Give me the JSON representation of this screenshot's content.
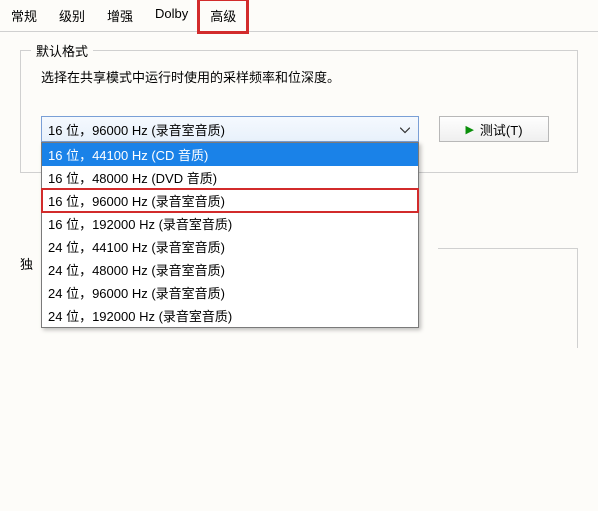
{
  "tabs": {
    "t0": "常规",
    "t1": "级别",
    "t2": "增强",
    "t3": "Dolby",
    "t4": "高级"
  },
  "group": {
    "defaultFormat": "默认格式",
    "instruction": "选择在共享模式中运行时使用的采样频率和位深度。"
  },
  "combo": {
    "selected": "16 位，96000 Hz (录音室音质)"
  },
  "options": {
    "o0": "16 位，44100 Hz (CD 音质)",
    "o1": "16 位，48000 Hz (DVD 音质)",
    "o2": "16 位，96000 Hz (录音室音质)",
    "o3": "16 位，192000 Hz (录音室音质)",
    "o4": "24 位，44100 Hz (录音室音质)",
    "o5": "24 位，48000 Hz (录音室音质)",
    "o6": "24 位，96000 Hz (录音室音质)",
    "o7": "24 位，192000 Hz (录音室音质)"
  },
  "buttons": {
    "test": "测试(T)"
  },
  "sidechar": "独"
}
